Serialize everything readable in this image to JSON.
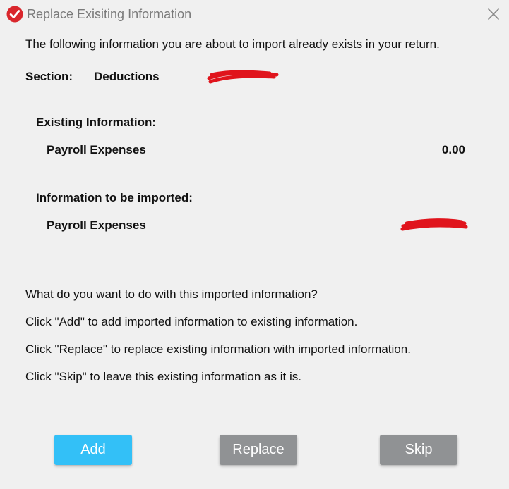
{
  "window": {
    "title": "Replace Exisiting Information"
  },
  "intro_text": "The following information you are about to import already exists in your return.",
  "section": {
    "label": "Section:",
    "value": "Deductions"
  },
  "existing": {
    "heading": "Existing Information:",
    "item_label": "Payroll Expenses",
    "item_amount": "0.00"
  },
  "imported": {
    "heading": "Information to be imported:",
    "item_label": "Payroll Expenses"
  },
  "instructions": [
    "What do you want to do with this imported information?",
    "Click \"Add\" to add imported information to existing information.",
    "Click \"Replace\" to replace existing information with imported information.",
    "Click \"Skip\" to leave this existing information as it is."
  ],
  "buttons": {
    "add": "Add",
    "replace": "Replace",
    "skip": "Skip"
  },
  "colors": {
    "background": "#f0f0f0",
    "title_icon": "#d9262c",
    "add_button": "#33c0f7",
    "secondary_button": "#909294",
    "redaction": "#e0141c"
  },
  "icons": {
    "title": "check-circle-icon",
    "close": "close-icon"
  }
}
